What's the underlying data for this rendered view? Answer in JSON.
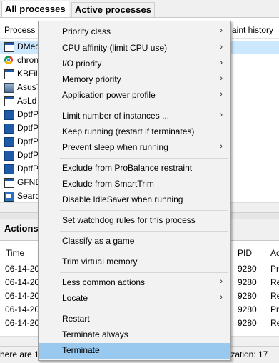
{
  "tabs": [
    {
      "label": "All processes"
    },
    {
      "label": "Active processes"
    }
  ],
  "process_table": {
    "headers": {
      "process": "Process",
      "restraint_history": "aint history"
    },
    "rows": [
      {
        "name": "DMed",
        "icon": "window-icon"
      },
      {
        "name": "chron",
        "icon": "chrome-icon"
      },
      {
        "name": "KBFil",
        "icon": "window-icon"
      },
      {
        "name": "AsusT",
        "icon": "asus-icon"
      },
      {
        "name": "AsLd",
        "icon": "window-icon"
      },
      {
        "name": "DptfP",
        "icon": "blue-square-icon"
      },
      {
        "name": "DptfP",
        "icon": "blue-square-icon"
      },
      {
        "name": "DptfP",
        "icon": "blue-square-icon"
      },
      {
        "name": "DptfP",
        "icon": "blue-square-icon"
      },
      {
        "name": "DptfP",
        "icon": "blue-square-icon"
      },
      {
        "name": "GFNE",
        "icon": "window-icon"
      },
      {
        "name": "Searc",
        "icon": "app-icon"
      }
    ]
  },
  "actions": {
    "title": "Actions",
    "headers": {
      "time": "Time",
      "pid": "PID",
      "action": "Ac"
    },
    "rows": [
      {
        "time": "06-14-20",
        "pid": "9280",
        "action": "Pr"
      },
      {
        "time": "06-14-20",
        "pid": "9280",
        "action": "Re"
      },
      {
        "time": "06-14-20",
        "pid": "9280",
        "action": "Re"
      },
      {
        "time": "06-14-20",
        "pid": "9280",
        "action": "Pr"
      },
      {
        "time": "06-14-20",
        "pid": "9280",
        "action": "Re"
      }
    ]
  },
  "statusbar": {
    "left": "here are 1",
    "right": "tilization: 17"
  },
  "context_menu": {
    "items": [
      {
        "label": "Priority class",
        "submenu": true
      },
      {
        "label": "CPU affinity (limit CPU use)",
        "submenu": true
      },
      {
        "label": "I/O priority",
        "submenu": true
      },
      {
        "label": "Memory priority",
        "submenu": true
      },
      {
        "label": "Application power profile",
        "submenu": true
      },
      {
        "label": "Limit number of instances ...",
        "submenu": true
      },
      {
        "label": "Keep running (restart if terminates)",
        "submenu": false
      },
      {
        "label": "Prevent sleep when running",
        "submenu": true
      },
      {
        "label": "Exclude from ProBalance restraint",
        "submenu": false
      },
      {
        "label": "Exclude from SmartTrim",
        "submenu": false
      },
      {
        "label": "Disable IdleSaver when running",
        "submenu": false
      },
      {
        "label": "Set watchdog rules for this process",
        "submenu": false
      },
      {
        "label": "Classify as a game",
        "submenu": false
      },
      {
        "label": "Trim virtual memory",
        "submenu": false
      },
      {
        "label": "Less common actions",
        "submenu": true
      },
      {
        "label": "Locate",
        "submenu": true
      },
      {
        "label": "Restart",
        "submenu": false
      },
      {
        "label": "Terminate always",
        "submenu": false
      },
      {
        "label": "Terminate",
        "submenu": false,
        "highlighted": true
      }
    ],
    "submenu_arrow": "›",
    "highlight_color": "#99c9ef"
  }
}
